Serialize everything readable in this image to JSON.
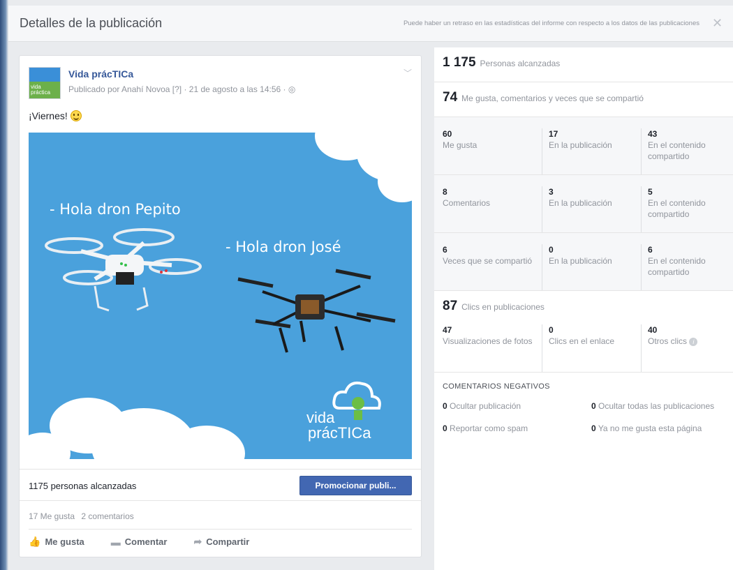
{
  "dialog": {
    "title": "Detalles de la publicación",
    "note": "Puede haber un retraso en las estadísticas del informe con respecto a los datos de las publicaciones",
    "close": "✕"
  },
  "post": {
    "page_name": "Vida prácTICa",
    "avatar_text": "vida práctica",
    "meta": "Publicado por Anahí Novoa [?] · 21 de agosto a las 14:56 · ◎",
    "text": "¡Viernes!",
    "image": {
      "caption_1": "- Hola dron Pepito",
      "caption_2": "- Hola dron José",
      "logo_line_1": "vida",
      "logo_line_2": "prácTICa"
    },
    "reach_text": "1175 personas alcanzadas",
    "promote_label": "Promocionar publi...",
    "likes_count": "17 Me gusta",
    "comments_count": "2 comentarios",
    "actions": {
      "like": "Me gusta",
      "comment": "Comentar",
      "share": "Compartir"
    }
  },
  "stats": {
    "reach": {
      "num": "1 175",
      "label": "Personas alcanzadas"
    },
    "engagement": {
      "num": "74",
      "label": "Me gusta, comentarios y veces que se compartió"
    },
    "likes": [
      {
        "num": "60",
        "label": "Me gusta"
      },
      {
        "num": "17",
        "label": "En la publicación"
      },
      {
        "num": "43",
        "label": "En el contenido compartido"
      }
    ],
    "comments": [
      {
        "num": "8",
        "label": "Comentarios"
      },
      {
        "num": "3",
        "label": "En la publicación"
      },
      {
        "num": "5",
        "label": "En el contenido compartido"
      }
    ],
    "shares": [
      {
        "num": "6",
        "label": "Veces que se compartió"
      },
      {
        "num": "0",
        "label": "En la publicación"
      },
      {
        "num": "6",
        "label": "En el contenido compartido"
      }
    ],
    "clicks": {
      "num": "87",
      "label": "Clics en publicaciones"
    },
    "click_breakdown": [
      {
        "num": "47",
        "label": "Visualizaciones de fotos"
      },
      {
        "num": "0",
        "label": "Clics en el enlace"
      },
      {
        "num": "40",
        "label": "Otros clics"
      }
    ],
    "negative": {
      "title": "COMENTARIOS NEGATIVOS",
      "items": [
        {
          "num": "0",
          "label": "Ocultar publicación"
        },
        {
          "num": "0",
          "label": "Ocultar todas las publicaciones"
        },
        {
          "num": "0",
          "label": "Reportar como spam"
        },
        {
          "num": "0",
          "label": "Ya no me gusta esta página"
        }
      ]
    }
  }
}
